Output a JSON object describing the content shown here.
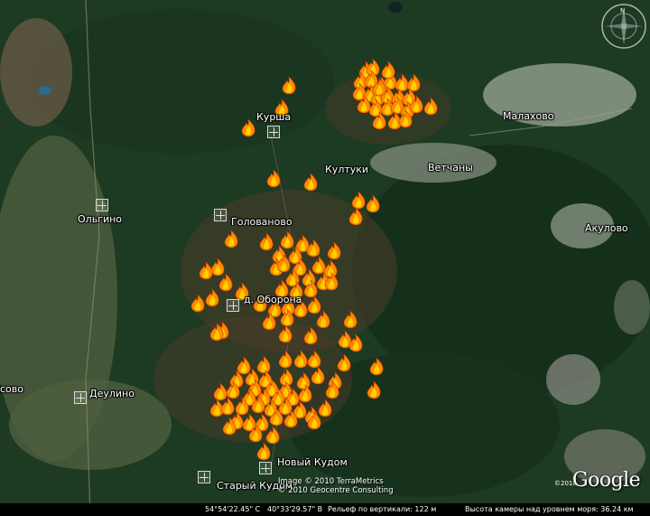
{
  "places": [
    {
      "id": "kursha",
      "label": "Курша"
    },
    {
      "id": "malakhovo",
      "label": "Малахово"
    },
    {
      "id": "kultuki",
      "label": "Култуки"
    },
    {
      "id": "vetchany",
      "label": "Ветчаны"
    },
    {
      "id": "olgino",
      "label": "Ольгино"
    },
    {
      "id": "golovanovo",
      "label": "Голованово"
    },
    {
      "id": "akulovo",
      "label": "Акулово"
    },
    {
      "id": "d-oborona",
      "label": "д. Оборона"
    },
    {
      "id": "osovo",
      "label": "сово"
    },
    {
      "id": "deulino",
      "label": "Деулино"
    },
    {
      "id": "novy-kudom",
      "label": "Новый Кудом"
    },
    {
      "id": "stary-kudom",
      "label": "Старый Кудом"
    }
  ],
  "copyright": {
    "line1": "Image © 2010 TerraMetrics",
    "line2": "© 2010 Geocentre Consulting"
  },
  "logo": {
    "text": "Google",
    "year": "©2010"
  },
  "status_bar": {
    "latitude": "54°54'22.45\" С",
    "longitude": "40°33'29.57\" В",
    "elevation": "Рельеф по вертикали:  122 м",
    "eye_altitude": "Высота камеры над уровнем моря:   36.24 км"
  },
  "compass": {
    "north_label": "N"
  },
  "colors": {
    "forest": "#1d3a22",
    "fire_outer": "#ff8a00",
    "fire_inner": "#ffd000",
    "status_bar": "#000000"
  },
  "icons": {
    "fire": "fire-icon",
    "place": "place-pin-icon",
    "compass": "compass-icon"
  }
}
